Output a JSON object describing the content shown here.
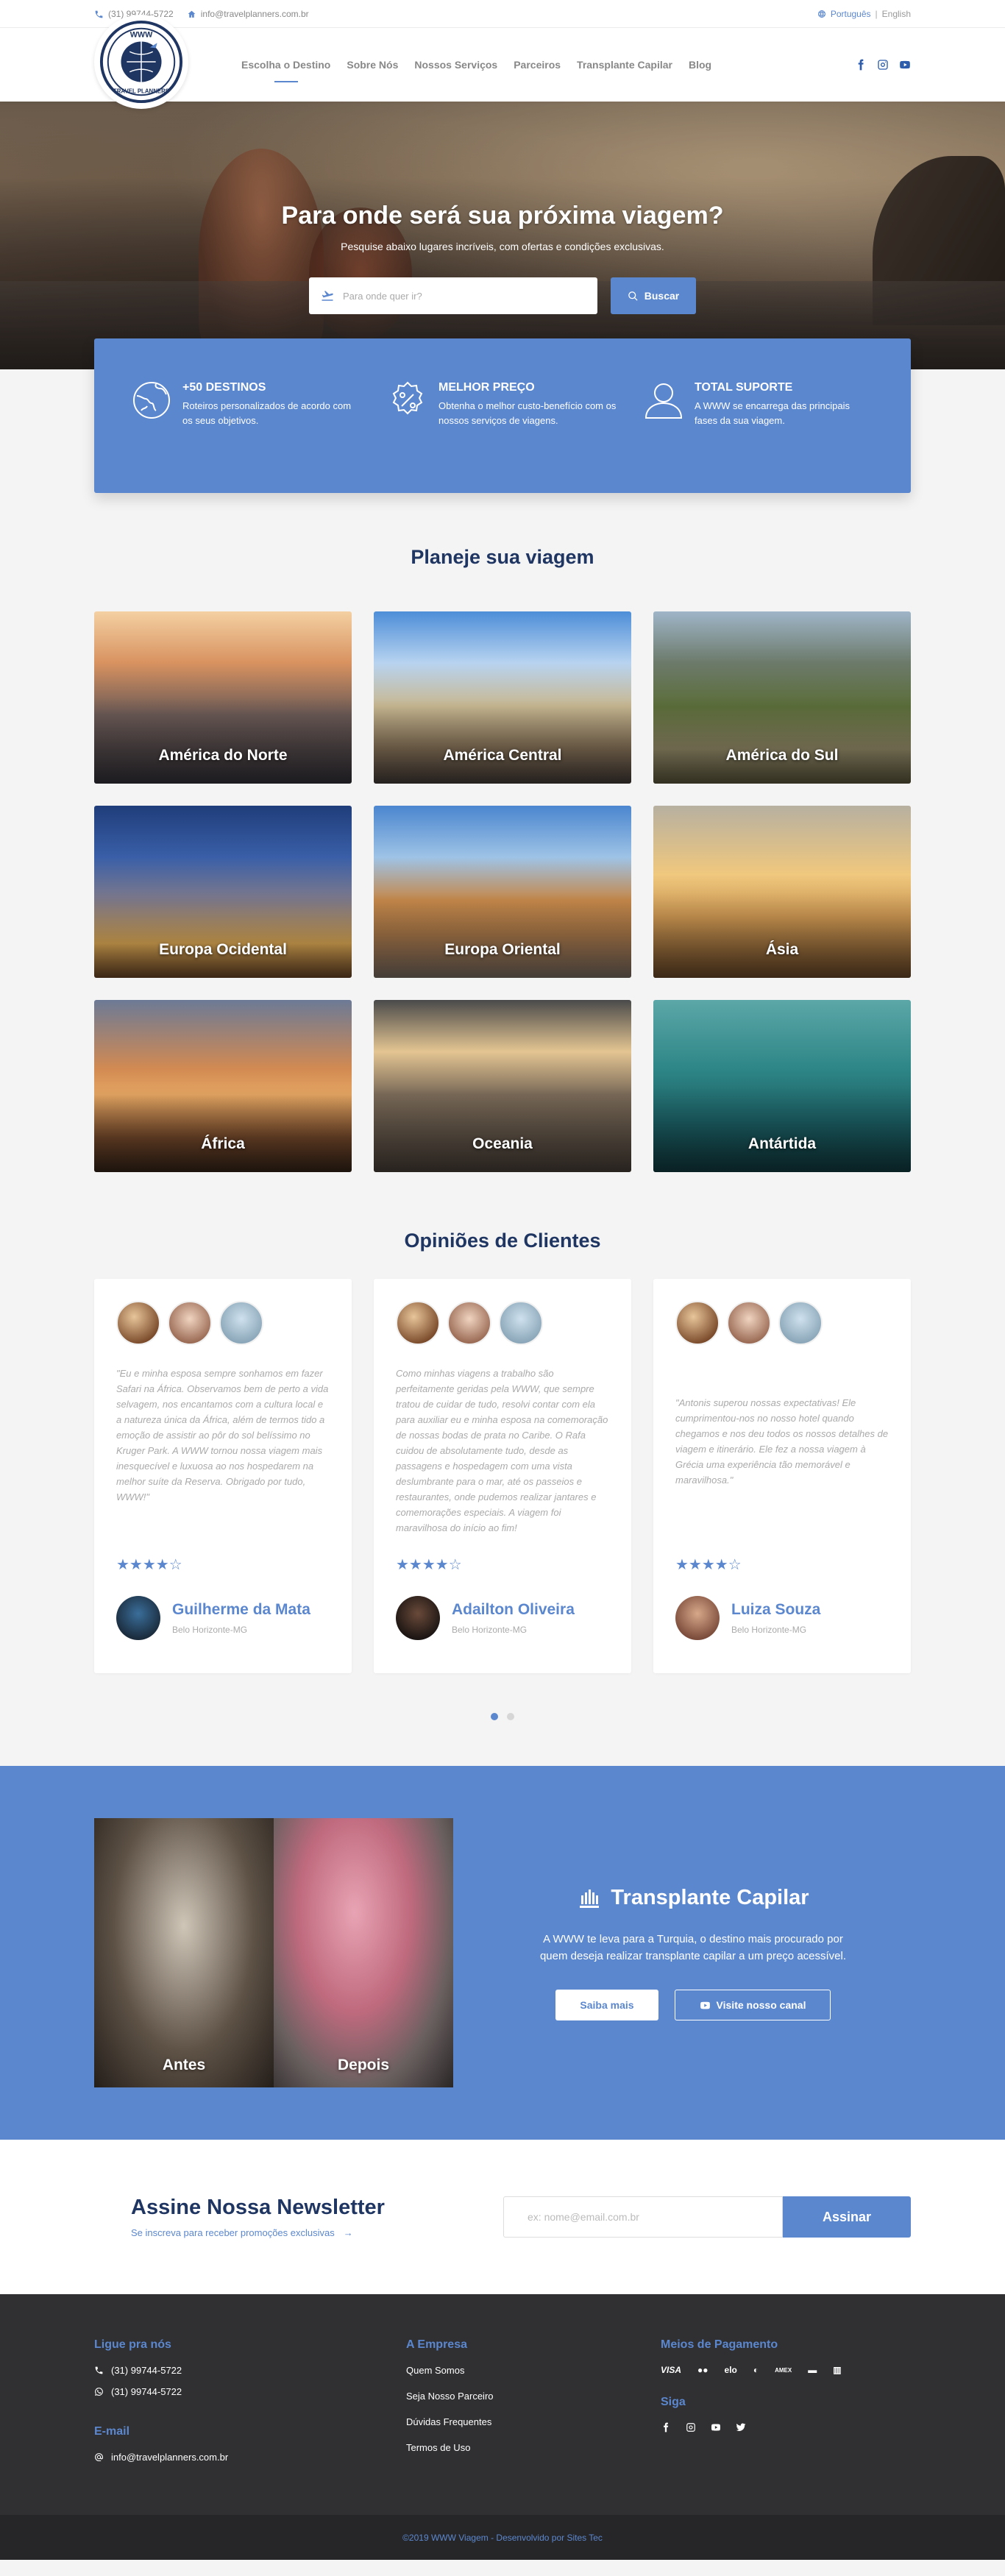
{
  "topbar": {
    "phone": "(31) 99744-5722",
    "email": "info@travelplanners.com.br",
    "lang_active": "Português",
    "lang_sep": "|",
    "lang_other": "English"
  },
  "logo": {
    "top": "WWW",
    "bottom": "TRAVEL PLANNERS"
  },
  "nav": {
    "items": [
      "Escolha o Destino",
      "Sobre Nós",
      "Nossos Serviços",
      "Parceiros",
      "Transplante Capilar",
      "Blog"
    ]
  },
  "hero": {
    "title": "Para onde será sua próxima viagem?",
    "subtitle": "Pesquise abaixo lugares incríveis, com ofertas e condições exclusivas.",
    "search_placeholder": "Para onde quer ir?",
    "search_button": "Buscar"
  },
  "features": [
    {
      "title": "+50 DESTINOS",
      "text": "Roteiros personalizados de acordo com os seus objetivos.",
      "icon": "globe-icon"
    },
    {
      "title": "MELHOR PREÇO",
      "text": "Obtenha o melhor custo-benefício com os nossos serviços de viagens.",
      "icon": "discount-badge-icon"
    },
    {
      "title": "TOTAL SUPORTE",
      "text": "A WWW se encarrega das principais fases da sua viagem.",
      "icon": "user-icon"
    }
  ],
  "destinations": {
    "title": "Planeje sua viagem",
    "items": [
      "América do Norte",
      "América Central",
      "América do Sul",
      "Europa Ocidental",
      "Europa Oriental",
      "Ásia",
      "África",
      "Oceania",
      "Antártida"
    ]
  },
  "testimonials": {
    "title": "Opiniões de Clientes",
    "items": [
      {
        "quote": "\"Eu e minha esposa sempre sonhamos em fazer Safari na África. Observamos bem de perto a vida selvagem, nos encantamos com a cultura local e a natureza única da África, além de termos tido a emoção de assistir ao pôr do sol belíssimo no Kruger Park. A WWW tornou nossa viagem mais inesquecível e luxuosa ao nos hospedarem na melhor suíte da Reserva. Obrigado por tudo, WWW!\"",
        "stars": "★★★★☆",
        "name": "Guilherme da Mata",
        "city": "Belo Horizonte-MG"
      },
      {
        "quote": "Como minhas viagens a trabalho são perfeitamente geridas pela WWW, que sempre tratou de cuidar de tudo, resolvi contar com ela para auxiliar eu e minha esposa na comemoração de nossas bodas de prata no Caribe. O Rafa cuidou de absolutamente tudo, desde as passagens e hospedagem com uma vista deslumbrante para o mar, até os passeios e restaurantes, onde pudemos realizar jantares e comemorações especiais. A viagem foi maravilhosa do início ao fim!",
        "stars": "★★★★☆",
        "name": "Adailton Oliveira",
        "city": "Belo Horizonte-MG"
      },
      {
        "quote": "\"Antonis superou nossas expectativas! Ele cumprimentou-nos no nosso hotel quando chegamos e nos deu todos os nossos detalhes de viagem e itinerário. Ele fez a nossa viagem à Grécia uma experiência tão memorável e maravilhosa.\"",
        "stars": "★★★★☆",
        "name": "Luiza Souza",
        "city": "Belo Horizonte-MG"
      }
    ]
  },
  "transplant": {
    "title": "Transplante Capilar",
    "text": "A WWW te leva para a Turquia, o destino mais procurado por quem deseja realizar transplante capilar a um preço acessível.",
    "before": "Antes",
    "after": "Depois",
    "btn_more": "Saiba mais",
    "btn_channel": "Visite nosso canal"
  },
  "newsletter": {
    "title": "Assine Nossa Newsletter",
    "subtitle": "Se inscreva para receber promoções exclusivas",
    "arrow": "→",
    "placeholder": "ex: nome@email.com.br",
    "button": "Assinar"
  },
  "footer": {
    "call_title": "Ligue pra nós",
    "phone1": "(31) 99744-5722",
    "phone2": "(31) 99744-5722",
    "email_title": "E-mail",
    "email": "info@travelplanners.com.br",
    "company_title": "A Empresa",
    "company_links": [
      "Quem Somos",
      "Seja Nosso Parceiro",
      "Dúvidas Frequentes",
      "Termos de Uso"
    ],
    "payment_title": "Meios de Pagamento",
    "payments": [
      "VISA",
      "●●",
      "elo",
      "◐",
      "AMEX",
      "▬",
      "▥"
    ],
    "follow_title": "Siga"
  },
  "copyright": "©2019 WWW Viagem - Desenvolvido por Sites Tec",
  "colors": {
    "accent": "#5b87cf",
    "navy": "#1f3562",
    "footer": "#303033"
  }
}
